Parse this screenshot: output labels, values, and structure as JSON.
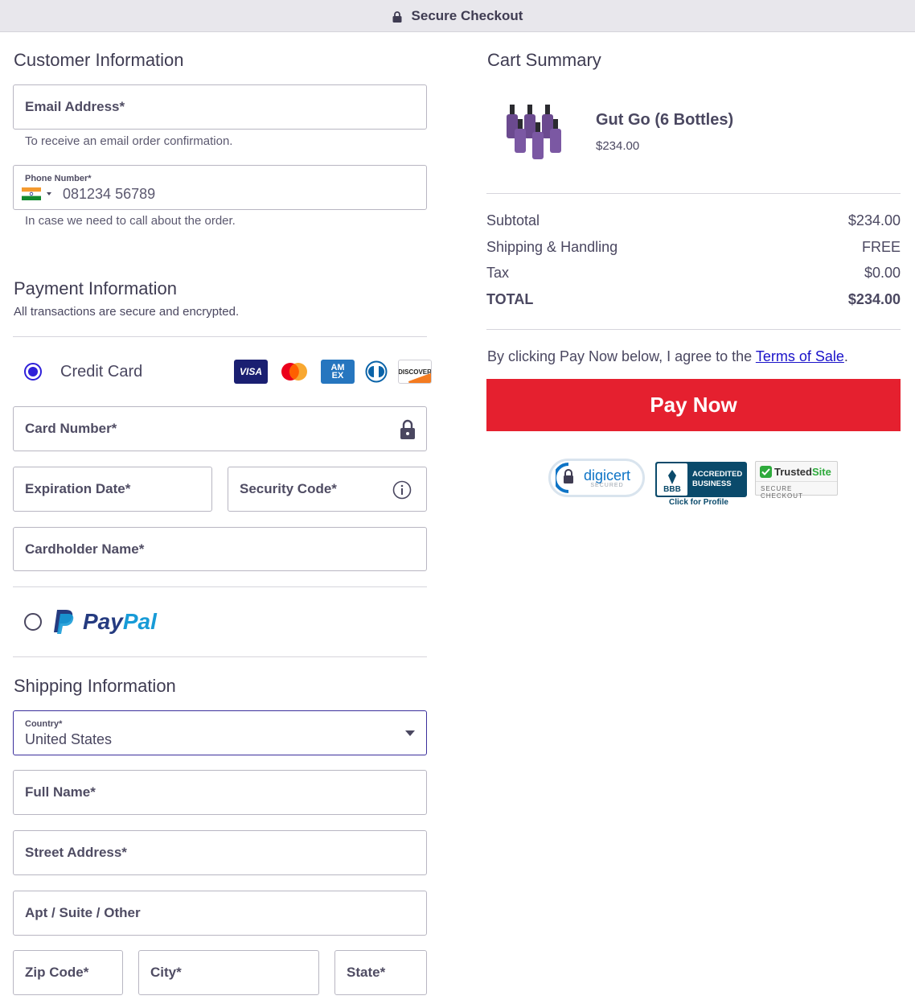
{
  "header": {
    "title": "Secure Checkout"
  },
  "customer": {
    "heading": "Customer Information",
    "email_label": "Email Address*",
    "email_help": "To receive an email order confirmation.",
    "phone_label": "Phone Number*",
    "phone_value": "081234 56789",
    "phone_help": "In case we need to call about the order."
  },
  "payment": {
    "heading": "Payment Information",
    "subheading": "All transactions are secure and encrypted.",
    "credit_card_label": "Credit Card",
    "card_logos": [
      "VISA",
      "Mastercard",
      "AMEX",
      "Diners",
      "DISCOVER"
    ],
    "card_number_label": "Card Number*",
    "expiration_label": "Expiration Date*",
    "security_label": "Security Code*",
    "cardholder_label": "Cardholder Name*",
    "paypal_label_a": "Pay",
    "paypal_label_b": "Pal",
    "selected": "credit_card"
  },
  "shipping": {
    "heading": "Shipping Information",
    "country_label": "Country*",
    "country_value": "United States",
    "full_name_label": "Full Name*",
    "street_label": "Street Address*",
    "apt_label": "Apt / Suite / Other",
    "zip_label": "Zip Code*",
    "city_label": "City*",
    "state_label": "State*"
  },
  "cart": {
    "heading": "Cart Summary",
    "product_name": "Gut Go (6 Bottles)",
    "product_price": "$234.00",
    "subtotal_label": "Subtotal",
    "subtotal_value": "$234.00",
    "shipping_label": "Shipping & Handling",
    "shipping_value": "FREE",
    "tax_label": "Tax",
    "tax_value": "$0.00",
    "total_label": "TOTAL",
    "total_value": "$234.00",
    "agree_text": "By clicking Pay Now below, I agree to the ",
    "terms_link": "Terms of Sale",
    "agree_end": ".",
    "pay_button": "Pay Now"
  },
  "badges": {
    "digicert": "digicert",
    "digicert_sub": "SECURED",
    "bbb_line1": "ACCREDITED",
    "bbb_line2": "BUSINESS",
    "bbb_mark": "BBB",
    "bbb_profile": "Click for Profile",
    "trusted_a": "Trusted",
    "trusted_b": "Site",
    "trusted_sub": "SECURE CHECKOUT"
  },
  "colors": {
    "primary": "#2f20d9",
    "pay_button": "#e5202f",
    "text": "#4a4760",
    "link": "#1a12c9"
  }
}
